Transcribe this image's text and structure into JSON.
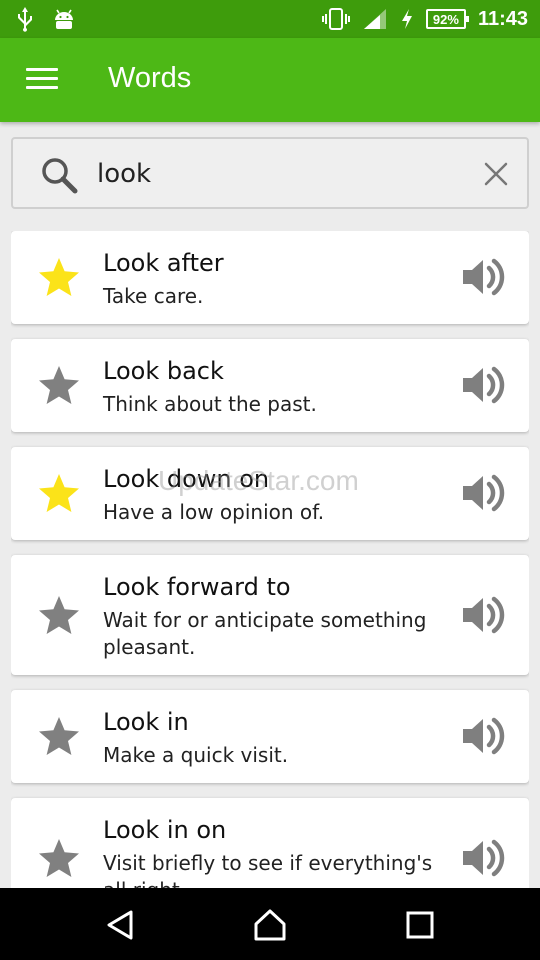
{
  "status_bar": {
    "battery": "92%",
    "clock": "11:43",
    "icons": [
      "usb-icon",
      "android-icon",
      "vibrate-icon",
      "signal-icon",
      "charging-icon",
      "battery-icon"
    ]
  },
  "app_bar": {
    "title": "Words",
    "menu_icon": "menu-icon"
  },
  "search": {
    "value": "look",
    "icon": "search-icon",
    "clear_icon": "close-icon"
  },
  "colors": {
    "status_bar": "#3e9c0c",
    "app_bar": "#4db816",
    "star_active": "#fbe319",
    "star_inactive": "#808080",
    "speaker": "#7f7f7f"
  },
  "words": [
    {
      "title": "Look after",
      "definition": "Take care.",
      "starred": true
    },
    {
      "title": "Look back",
      "definition": "Think about the past.",
      "starred": false
    },
    {
      "title": "Look down on",
      "definition": "Have a low opinion of.",
      "starred": true
    },
    {
      "title": "Look forward to",
      "definition": "Wait for or anticipate something pleasant.",
      "starred": false
    },
    {
      "title": "Look in",
      "definition": "Make a quick visit.",
      "starred": false
    },
    {
      "title": "Look in on",
      "definition": "Visit briefly to see if everything's all right.",
      "starred": false
    }
  ],
  "watermark": "UpdateStar.com",
  "nav_bar": {
    "icons": [
      "back-icon",
      "home-icon",
      "recents-icon"
    ]
  }
}
